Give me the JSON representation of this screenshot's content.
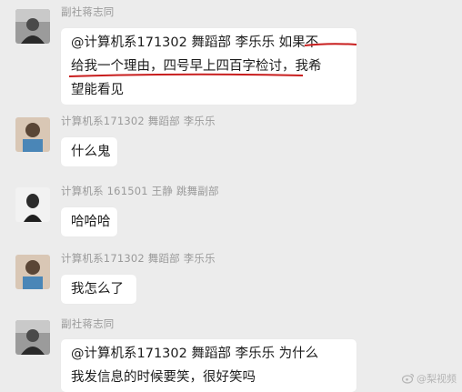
{
  "messages": [
    {
      "sender": "副社蒋志同",
      "lines": [
        "@计算机系171302   舞蹈部   李乐乐 如果不",
        "给我一个理由，四号早上四百字检讨，我希",
        "望能看见"
      ]
    },
    {
      "sender": "计算机系171302   舞蹈部   李乐乐",
      "text": "什么鬼"
    },
    {
      "sender": "计算机系  161501  王静  跳舞副部",
      "text": "哈哈哈"
    },
    {
      "sender": "计算机系171302   舞蹈部   李乐乐",
      "text": "我怎么了"
    },
    {
      "sender": "副社蒋志同",
      "lines": [
        "@计算机系171302   舞蹈部   李乐乐 为什么",
        "我发信息的时候要笑，很好笑吗"
      ]
    }
  ],
  "watermark": "@梨视频",
  "colors": {
    "underline": "#c81e1e",
    "background": "#ececec",
    "bubble": "#ffffff",
    "sender": "#9a9a9a"
  }
}
